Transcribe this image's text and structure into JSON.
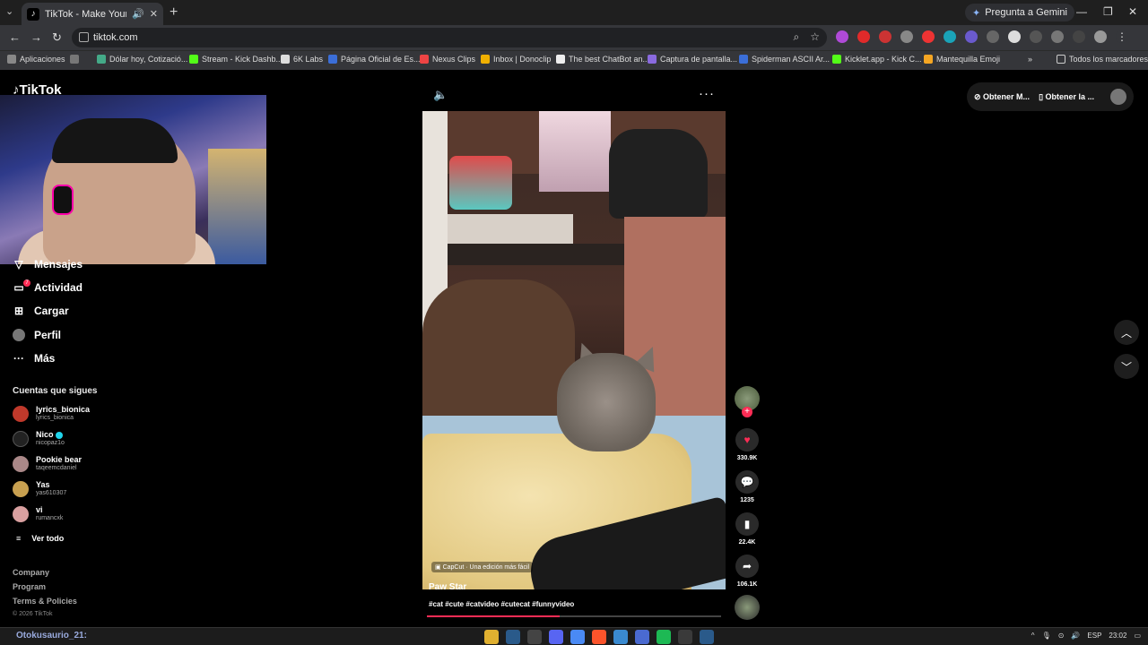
{
  "browser": {
    "tab_title": "TikTok - Make Your Day",
    "url": "tiktok.com",
    "gemini_label": "Pregunta a Gemini",
    "bookmarks": [
      "Aplicaciones",
      "Dólar hoy, Cotizació...",
      "Stream - Kick Dashb...",
      "6K Labs",
      "Página Oficial de Es...",
      "Nexus Clips",
      "Inbox | Donoclip",
      "The best ChatBot an...",
      "Captura de pantalla...",
      "Spiderman ASCII Ar...",
      "Kicklet.app - Kick C...",
      "Mantequilla Emoji"
    ],
    "all_bookmarks": "Todos los marcadores"
  },
  "tiktok": {
    "logo": "TikTok",
    "nav": {
      "mensajes": "Mensajes",
      "actividad": "Actividad",
      "actividad_badge": "7",
      "cargar": "Cargar",
      "perfil": "Perfil",
      "mas": "Más"
    },
    "following_title": "Cuentas que sigues",
    "following": [
      {
        "name": "lyrics_bionica",
        "user": "lyrics_bionica",
        "verified": false
      },
      {
        "name": "Nico",
        "user": "nicopaz1o",
        "verified": true
      },
      {
        "name": "Pookie bear",
        "user": "taqeemcdaniel",
        "verified": false
      },
      {
        "name": "Yas",
        "user": "yas610307",
        "verified": false
      },
      {
        "name": "vi",
        "user": "rumancxk",
        "verified": false
      }
    ],
    "see_all": "Ver todo",
    "footer": {
      "company": "Company",
      "program": "Program",
      "terms": "Terms & Policies",
      "copyright": "© 2026 TikTok"
    },
    "topright": {
      "get_coins": "Obtener M...",
      "get_app": "Obtener la ..."
    },
    "video": {
      "capcut": "CapCut · Una edición más fácil",
      "title": "Paw Star",
      "tags": "#cat #cute #catvideo #cutecat #funnyvideo",
      "progress": 0.45
    },
    "actions": {
      "likes": "330.9K",
      "comments": "1235",
      "saves": "22.4K",
      "shares": "106.1K"
    }
  },
  "taskbar": {
    "stream_user": "Otokusaurio_21:",
    "lang": "ESP",
    "time": "23:02"
  }
}
